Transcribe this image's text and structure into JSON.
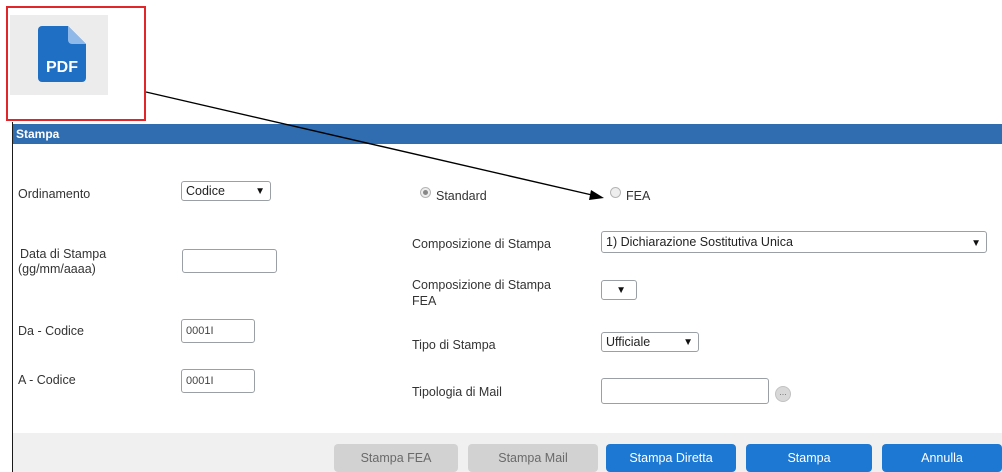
{
  "icon": {
    "name": "pdf-document-icon",
    "label": "PDF"
  },
  "panel": {
    "title": "Stampa"
  },
  "fields": {
    "ordinamento_label": "Ordinamento",
    "ordinamento_value": "Codice",
    "data_stampa_label_1": "Data di Stampa",
    "data_stampa_label_2": "(gg/mm/aaaa)",
    "data_stampa_value": "",
    "da_codice_label": "Da - Codice",
    "da_codice_value": "0001I",
    "a_codice_label": "A  - Codice",
    "a_codice_value": "0001I",
    "radio_standard_label": "Standard",
    "radio_fea_label": "FEA",
    "composizione_label": "Composizione di Stampa",
    "composizione_value": "1) Dichiarazione Sostitutiva Unica",
    "composizione_fea_label_1": "Composizione di Stampa",
    "composizione_fea_label_2": "FEA",
    "composizione_fea_value": "",
    "tipo_stampa_label": "Tipo di Stampa",
    "tipo_stampa_value": "Ufficiale",
    "tipologia_mail_label": "Tipologia di Mail",
    "tipologia_mail_value": "",
    "ellipsis": "..."
  },
  "buttons": {
    "stampa_fea": "Stampa FEA",
    "stampa_mail": "Stampa Mail",
    "stampa_diretta": "Stampa Diretta",
    "stampa": "Stampa",
    "annulla": "Annulla"
  },
  "colors": {
    "header_blue": "#2f6db0",
    "primary_button": "#1c78d2",
    "callout_red": "#e0262b",
    "pdf_icon_blue": "#1f6fc5"
  }
}
